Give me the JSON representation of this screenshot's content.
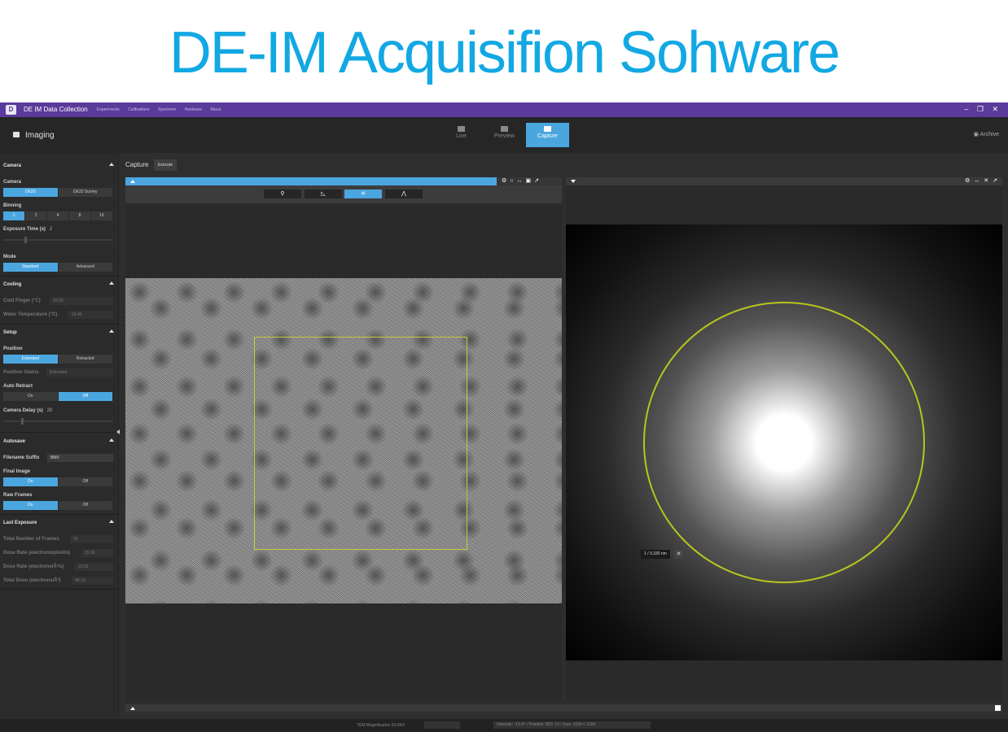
{
  "banner": {
    "title": "DE-IM  Acquisifion Sohware"
  },
  "titlebar": {
    "app_name": "DE IM  Data Collection",
    "menus": [
      "Experiments",
      "Calibrations",
      "Specimen",
      "Hardware",
      "About"
    ],
    "accent_color": "#5a3a9a"
  },
  "topbar": {
    "mode": "Imaging",
    "tabs": [
      {
        "label": "Live",
        "icon": "video-icon"
      },
      {
        "label": "Preview",
        "icon": "camera-icon"
      },
      {
        "label": "Capture",
        "icon": "camera-icon"
      }
    ],
    "active_tab": "Capture",
    "archive": "Archive",
    "accent_color": "#4ba6df"
  },
  "sidebar": {
    "camera": {
      "title": "Camera",
      "camera_label": "Camera",
      "camera_options": [
        "DE20",
        "DE20 Survey"
      ],
      "camera_selected": "DE20",
      "binning_label": "Binning",
      "binning_options": [
        "1",
        "2",
        "4",
        "8",
        "16"
      ],
      "binning_selected": "1",
      "exposure_label": "Exposure Time (s)",
      "exposure_value": "2",
      "mode_label": "Mode",
      "mode_options": [
        "Standard",
        "Advanced"
      ],
      "mode_selected": "Standard"
    },
    "cooling": {
      "title": "Cooling",
      "cold_finger_label": "Cold Finger (°C)",
      "cold_finger_value": "23.50",
      "water_label": "Water Temperature (°C)",
      "water_value": "19.40"
    },
    "setup": {
      "title": "Setup",
      "position_label": "Position",
      "position_options": [
        "Extended",
        "Retracted"
      ],
      "position_selected": "Extended",
      "position_status_label": "Position Status",
      "position_status_value": "Extended",
      "auto_retract_label": "Auto Retract",
      "auto_retract_options": [
        "On",
        "Off"
      ],
      "auto_retract_selected": "Off",
      "camera_delay_label": "Camera Delay (s)",
      "camera_delay_value": "20"
    },
    "autosave": {
      "title": "Autosave",
      "filename_label": "Filename Suffix",
      "filename_value": "BMV",
      "final_image_label": "Final Image",
      "final_image_options": [
        "On",
        "Off"
      ],
      "final_image_selected": "On",
      "raw_frames_label": "Raw Frames",
      "raw_frames_options": [
        "On",
        "Off"
      ],
      "raw_frames_selected": "On"
    },
    "last_exposure": {
      "title": "Last Exposure",
      "total_frames_label": "Total Number of Frames",
      "total_frames_value": "32",
      "dose_rate_px_label": "Dose Rate (electrons/pixel/s)",
      "dose_rate_px_value": "25.90",
      "dose_rate_a_label": "Dose Rate (electrons/Å²/s)",
      "dose_rate_a_value": "23.56",
      "total_dose_label": "Total Dose (electrons/Å²)",
      "total_dose_value": "49.13"
    }
  },
  "main": {
    "capture_label": "Capture",
    "execute_label": "Execute",
    "ring_label": "1 / 0.330  nm"
  },
  "status": {
    "magnification": "TEM Magnification  50.0KX",
    "info": "Intensity: -13.47 / Position: 850, 10 / Size: 1024 x 1024"
  }
}
